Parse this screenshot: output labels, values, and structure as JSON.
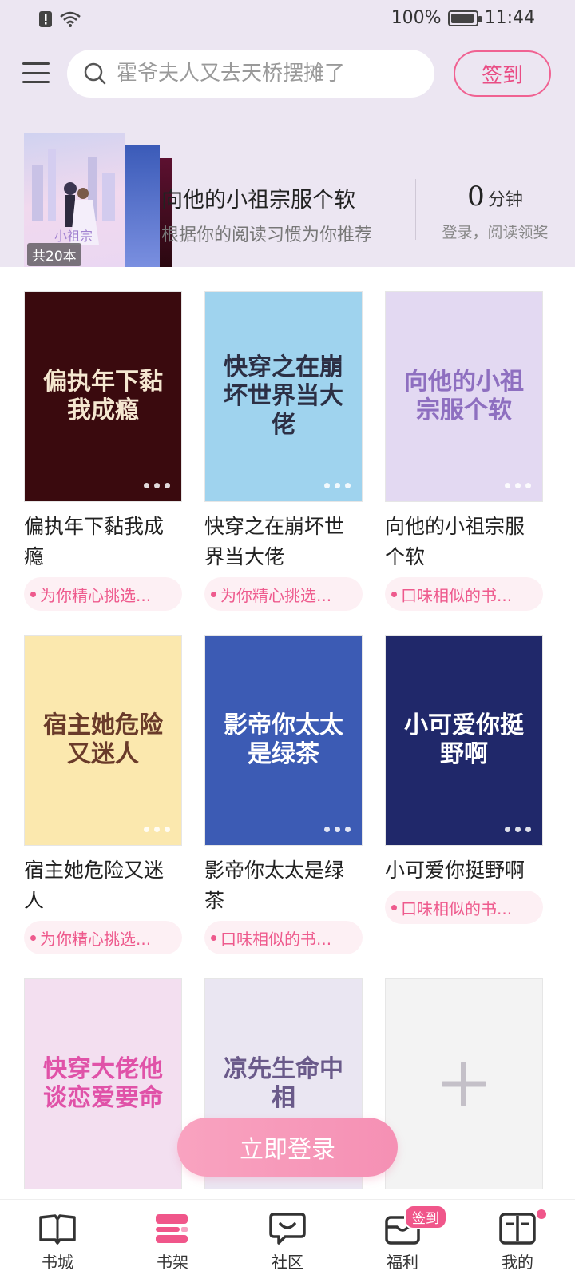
{
  "status_bar": {
    "battery": "100%",
    "time": "11:44",
    "battery_level": 0.95
  },
  "header": {
    "search_placeholder": "霍爷夫人又去天桥摆摊了",
    "checkin_label": "签到"
  },
  "recommendation": {
    "count_label": "共20本",
    "title": "向他的小祖宗服个软",
    "subtitle": "根据你的阅读习惯为你推荐",
    "minutes": "0",
    "minutes_unit": "分钟",
    "login_hint": "登录，阅读领奖"
  },
  "books": [
    {
      "title": "偏执年下黏我成瘾",
      "tag": "为你精心挑选...",
      "cover_text": "偏执年下黏我成瘾",
      "cover_bg": "#3a0a0e",
      "cover_fg": "#f5e7d0"
    },
    {
      "title": "快穿之在崩坏世界当大佬",
      "tag": "为你精心挑选...",
      "cover_text": "快穿之在崩坏世界当大佬",
      "cover_bg": "#9fd3ee",
      "cover_fg": "#2c2f44"
    },
    {
      "title": "向他的小祖宗服个软",
      "tag": "口味相似的书...",
      "cover_text": "向他的小祖宗服个软",
      "cover_bg": "#e3d9f2",
      "cover_fg": "#8e6fc0"
    },
    {
      "title": "宿主她危险又迷人",
      "tag": "为你精心挑选...",
      "cover_text": "宿主她危险又迷人",
      "cover_bg": "#fbe8ae",
      "cover_fg": "#6a3b2a"
    },
    {
      "title": "影帝你太太是绿茶",
      "tag": "口味相似的书...",
      "cover_text": "影帝你太太是绿茶",
      "cover_bg": "#3c5bb4",
      "cover_fg": "#ffffff"
    },
    {
      "title": "小可爱你挺野啊",
      "tag": "口味相似的书...",
      "cover_text": "小可爱你挺野啊",
      "cover_bg": "#20286a",
      "cover_fg": "#ffffff"
    },
    {
      "title": "",
      "tag": "",
      "cover_text": "快穿大佬他谈恋爱要命",
      "cover_bg": "#f3dff0",
      "cover_fg": "#e052a8"
    },
    {
      "title": "",
      "tag": "",
      "cover_text": "凉先生命中相",
      "cover_bg": "#eae6f2",
      "cover_fg": "#6a5a8a"
    }
  ],
  "login_button": "立即登录",
  "nav": [
    {
      "label": "书城",
      "icon": "book-open-icon"
    },
    {
      "label": "书架",
      "icon": "bookshelf-icon"
    },
    {
      "label": "社区",
      "icon": "chat-icon"
    },
    {
      "label": "福利",
      "icon": "gift-box-icon",
      "badge": "签到"
    },
    {
      "label": "我的",
      "icon": "profile-card-icon"
    }
  ],
  "colors": {
    "accent": "#ee5a8d",
    "header_bg": "#ece6f2"
  }
}
